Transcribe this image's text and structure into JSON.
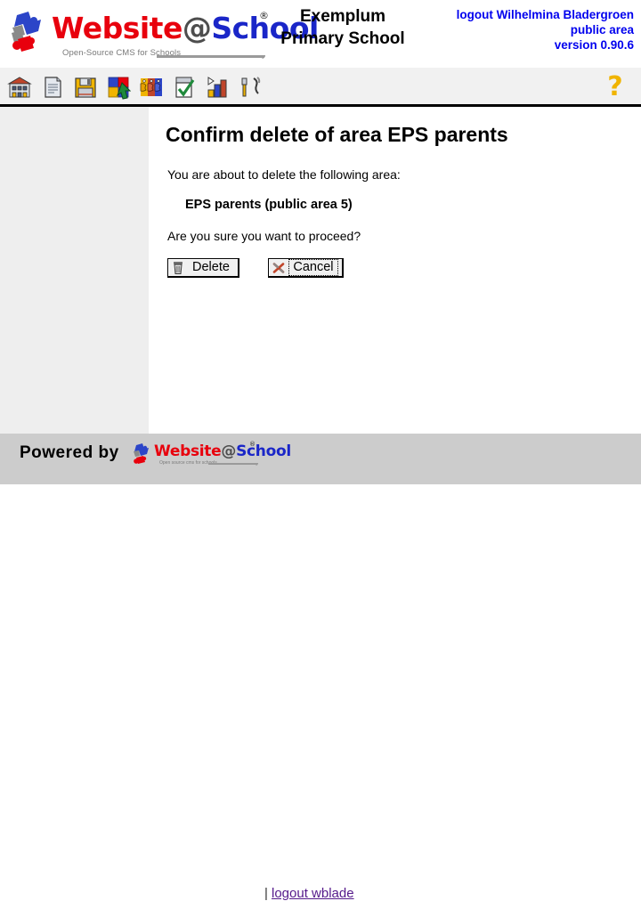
{
  "header": {
    "logo": {
      "word_part1": "Website",
      "word_at": "@",
      "word_part2": "School",
      "registered": "®",
      "tagline": "Open-Source CMS for Schools"
    },
    "school_name_line1": "Exemplum",
    "school_name_line2": "Primary School",
    "session": {
      "logout_label": "logout Wilhelmina Bladergroen",
      "area_label": "public area",
      "version_label": "version 0.90.6"
    }
  },
  "toolbar": {
    "items": [
      {
        "name": "schoolbuilding-icon",
        "title": "Website"
      },
      {
        "name": "page-icon",
        "title": "Page"
      },
      {
        "name": "floppy-save-icon",
        "title": "Save"
      },
      {
        "name": "modules-icon",
        "title": "Modules"
      },
      {
        "name": "users-icon",
        "title": "Users"
      },
      {
        "name": "checklist-icon",
        "title": "Tasks"
      },
      {
        "name": "statistics-icon",
        "title": "Statistics"
      },
      {
        "name": "tools-icon",
        "title": "Tools"
      }
    ],
    "help_label": "?"
  },
  "main": {
    "title": "Confirm delete of area EPS parents",
    "intro": "You are about to delete the following area:",
    "area_name": "EPS parents (public area 5)",
    "confirm_question": "Are you sure you want to proceed?",
    "buttons": [
      {
        "label": "Delete",
        "icon": "trash-icon",
        "focused": false
      },
      {
        "label": "Cancel",
        "icon": "red-x-icon",
        "focused": true
      }
    ]
  },
  "footer": {
    "powered_by": "Powered by",
    "logo": {
      "word_part1": "Website",
      "word_at": "@",
      "word_part2": "School",
      "registered": "®",
      "tagline": "Open source cms for schools"
    },
    "separator": "|",
    "logout_label": "logout wblade"
  },
  "colors": {
    "logo_red": "#e8000d",
    "logo_blue": "#1a26c8",
    "logo_gray": "#4d4d4d",
    "session_blue": "#0000ee",
    "help_yellow": "#f0b400",
    "footer_bg": "#cccccc",
    "sidebar_bg": "#eeeeee",
    "toolbar_bg": "#f1f1f1",
    "link_visited": "#551a8b"
  }
}
